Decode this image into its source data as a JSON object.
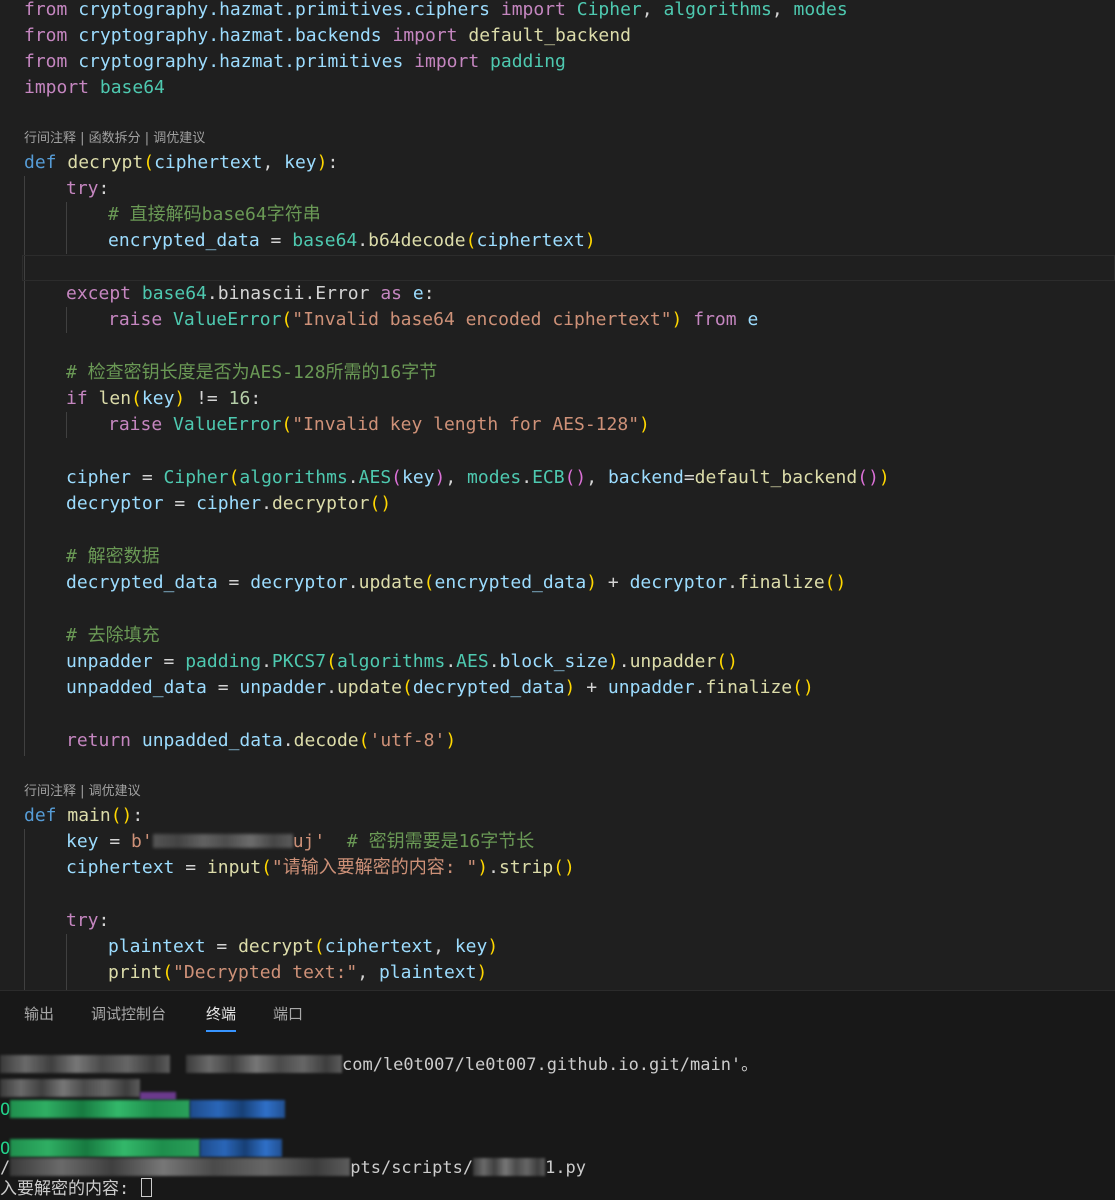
{
  "editor": {
    "codelens_1": "行间注释 | 函数拆分 | 调优建议",
    "codelens_2": "行间注释 | 调优建议",
    "imports": {
      "l1": {
        "kw1": "from",
        "mod": "cryptography.hazmat.primitives.ciphers",
        "kw2": "import",
        "names": [
          "Cipher",
          "algorithms",
          "modes"
        ]
      },
      "l2": {
        "kw1": "from",
        "mod": "cryptography.hazmat.backends",
        "kw2": "import",
        "name": "default_backend"
      },
      "l3": {
        "kw1": "from",
        "mod": "cryptography.hazmat.primitives",
        "kw2": "import",
        "name": "padding"
      },
      "l4": {
        "kw1": "import",
        "name": "base64"
      }
    },
    "decrypt_fn": {
      "def": "def",
      "name": "decrypt",
      "params": [
        "ciphertext",
        "key"
      ],
      "try": "try",
      "comment_decode": "# 直接解码base64字符串",
      "encrypted_data": "encrypted_data",
      "b64decode": "b64decode",
      "except": "except",
      "binascii": "binascii",
      "error": "Error",
      "as": "as",
      "e": "e",
      "raise": "raise",
      "value_error": "ValueError",
      "err_b64": "\"Invalid base64 encoded ciphertext\"",
      "from": "from",
      "comment_key": "# 检查密钥长度是否为AES-128所需的16字节",
      "if": "if",
      "len": "len",
      "neq": "!=",
      "sixteen": "16",
      "err_key": "\"Invalid key length for AES-128\"",
      "cipher": "cipher",
      "Cipher": "Cipher",
      "algorithms": "algorithms",
      "AES": "AES",
      "modes": "modes",
      "ECB": "ECB",
      "backend": "backend",
      "default_backend": "default_backend",
      "decryptor": "decryptor",
      "comment_decrypt": "# 解密数据",
      "decrypted_data": "decrypted_data",
      "update": "update",
      "finalize": "finalize",
      "comment_unpad": "# 去除填充",
      "unpadder": "unpadder",
      "padding": "padding",
      "PKCS7": "PKCS7",
      "block_size": "block_size",
      "unpadded_data": "unpadded_data",
      "return": "return",
      "decode": "decode",
      "utf8": "'utf-8'"
    },
    "main_fn": {
      "def": "def",
      "name": "main",
      "key": "key",
      "key_prefix": "b'",
      "key_visible": "uj'",
      "comment_key": "# 密钥需要是16字节长",
      "ciphertext": "ciphertext",
      "input": "input",
      "prompt": "\"请输入要解密的内容: \"",
      "strip": "strip",
      "try": "try",
      "plaintext": "plaintext",
      "decrypt": "decrypt",
      "print": "print",
      "print_label": "\"Decrypted text:\""
    }
  },
  "panel": {
    "tabs": [
      {
        "label": "输出",
        "active": false
      },
      {
        "label": "调试控制台",
        "active": false
      },
      {
        "label": "终端",
        "active": true
      },
      {
        "label": "端口",
        "active": false
      }
    ],
    "terminal": {
      "line1_visible": "com/le0t007/le0t007.github.io.git/main'。",
      "line3_prefix": "O",
      "line4_prefix": "O",
      "line5_prefix": "/",
      "line5_visible": "pts/scripts/",
      "line5_suffix": "1.py",
      "prompt_line": "入要解密的内容: "
    }
  },
  "colors": {
    "background": "#1f1f1f",
    "panel_background": "#181818",
    "keyword": "#c586c0",
    "function": "#dcdcaa",
    "variable": "#9cdcfe",
    "class": "#4ec9b0",
    "string": "#ce9178",
    "comment": "#6a9955",
    "active_tab_underline": "#3794ff"
  }
}
